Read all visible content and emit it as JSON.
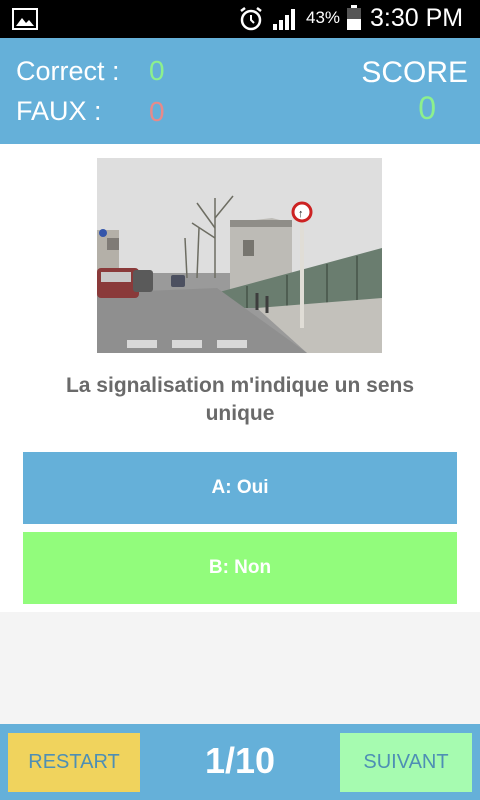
{
  "status_bar": {
    "battery": "43%",
    "time": "3:30 PM"
  },
  "score_panel": {
    "correct_label": "Correct :",
    "correct_value": "0",
    "faux_label": "FAUX :",
    "faux_value": "0",
    "score_label": "SCORE",
    "score_value": "0"
  },
  "quiz": {
    "question": "La signalisation m'indique un sens unique",
    "answers": [
      {
        "label": "A: Oui"
      },
      {
        "label": "B: Non"
      }
    ]
  },
  "footer": {
    "restart_label": "RESTART",
    "progress": "1/10",
    "next_label": "SUIVANT"
  },
  "colors": {
    "accent_blue": "#65b0d9",
    "answer_green": "#92fc7c",
    "correct_green": "#8df08d",
    "faux_red": "#e88a8a",
    "restart_yellow": "#f0d35d",
    "next_green": "#a6fbb0"
  },
  "icons": [
    "image-icon",
    "alarm-icon",
    "signal-icon",
    "battery-icon"
  ]
}
